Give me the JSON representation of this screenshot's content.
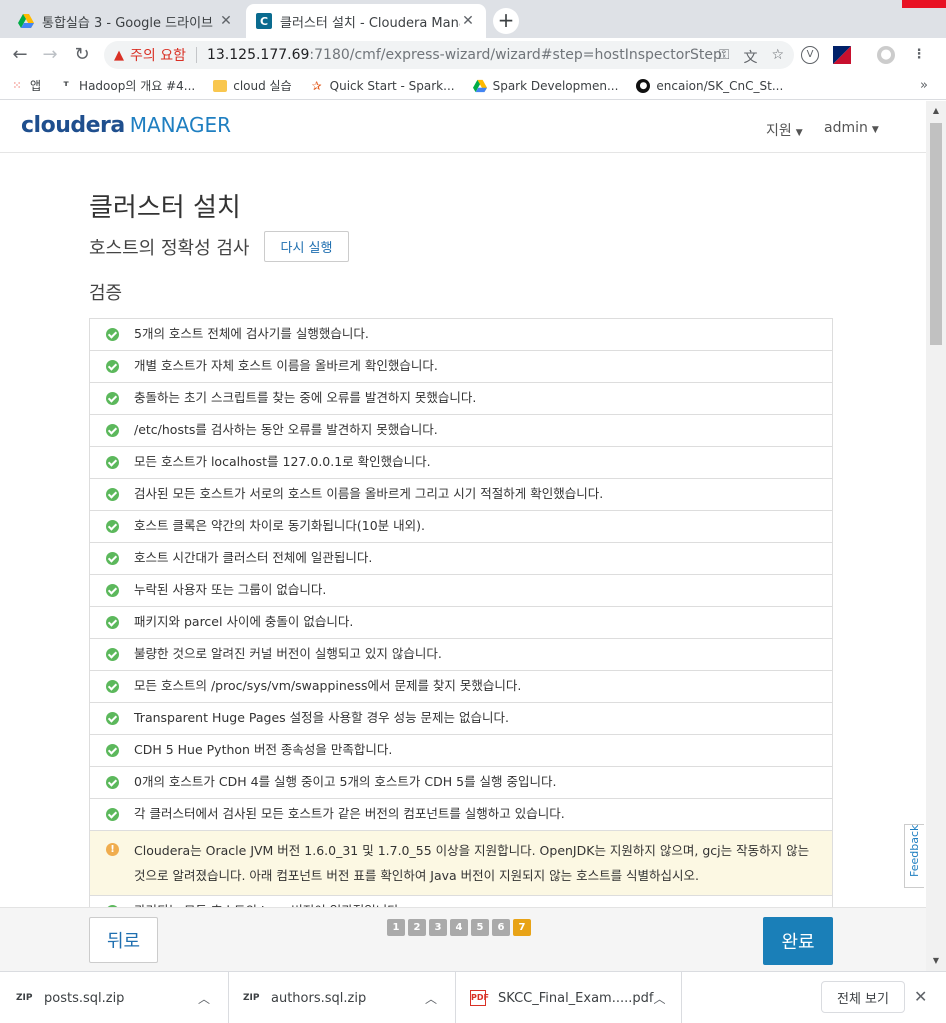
{
  "browser": {
    "tabs": [
      {
        "title": "통합실습 3 - Google 드라이브"
      },
      {
        "title": "클러스터 설치 - Cloudera Mana"
      }
    ],
    "address": {
      "warning": "주의 요함",
      "host": "13.125.177.69",
      "path": ":7180/cmf/express-wizard/wizard#step=hostInspectorStep"
    },
    "bookmarks": [
      {
        "label": "앱",
        "icon": "apps-grid-icon"
      },
      {
        "label": "Hadoop의 개요 #4...",
        "icon": "hadoop-icon"
      },
      {
        "label": "cloud 실습",
        "icon": "folder-icon"
      },
      {
        "label": "Quick Start - Spark...",
        "icon": "spark-star-icon"
      },
      {
        "label": "Spark Developmen...",
        "icon": "google-drive-icon"
      },
      {
        "label": "encaion/SK_CnC_St...",
        "icon": "github-icon"
      }
    ],
    "bookmarks_more": "»"
  },
  "header": {
    "logo_brand": "cloudera",
    "logo_product": "MANAGER",
    "support_menu": "지원",
    "user_menu": "admin"
  },
  "wizard": {
    "title": "클러스터 설치",
    "subtitle": "호스트의 정확성 검사",
    "rerun_label": "다시 실행",
    "section": "검증",
    "checks": [
      {
        "status": "ok",
        "text": "5개의 호스트 전체에 검사기를 실행했습니다."
      },
      {
        "status": "ok",
        "text": "개별 호스트가 자체 호스트 이름을 올바르게 확인했습니다."
      },
      {
        "status": "ok",
        "text": "충돌하는 초기 스크립트를 찾는 중에 오류를 발견하지 못했습니다."
      },
      {
        "status": "ok",
        "text": "/etc/hosts를 검사하는 동안 오류를 발견하지 못했습니다."
      },
      {
        "status": "ok",
        "text": "모든 호스트가 localhost를 127.0.0.1로 확인했습니다."
      },
      {
        "status": "ok",
        "text": "검사된 모든 호스트가 서로의 호스트 이름을 올바르게 그리고 시기 적절하게 확인했습니다."
      },
      {
        "status": "ok",
        "text": "호스트 클록은 약간의 차이로 동기화됩니다(10분 내외)."
      },
      {
        "status": "ok",
        "text": "호스트 시간대가 클러스터 전체에 일관됩니다."
      },
      {
        "status": "ok",
        "text": "누락된 사용자 또는 그룹이 없습니다."
      },
      {
        "status": "ok",
        "text": "패키지와 parcel 사이에 충돌이 없습니다."
      },
      {
        "status": "ok",
        "text": "불량한 것으로 알려진 커널 버전이 실행되고 있지 않습니다."
      },
      {
        "status": "ok",
        "text": "모든 호스트의 /proc/sys/vm/swappiness에서 문제를 찾지 못했습니다."
      },
      {
        "status": "ok",
        "text": "Transparent Huge Pages 설정을 사용할 경우 성능 문제는 없습니다."
      },
      {
        "status": "ok",
        "text": "CDH 5 Hue Python 버전 종속성을 만족합니다."
      },
      {
        "status": "ok",
        "text": "0개의 호스트가 CDH 4를 실행 중이고 5개의 호스트가 CDH 5를 실행 중입니다."
      },
      {
        "status": "ok",
        "text": "각 클러스터에서 검사된 모든 호스트가 같은 버전의 컴포넌트를 실행하고 있습니다."
      },
      {
        "status": "warn",
        "text": "Cloudera는 Oracle JVM 버전 1.6.0_31 및 1.7.0_55 이상을 지원합니다. OpenJDK는 지원하지 않으며, gcj는 작동하지 않는 것으로 알려졌습니다. 아래 컴포넌트 버전 표를 확인하여 Java 버전이 지원되지 않는 호스트를 식별하십시오."
      },
      {
        "status": "ok",
        "text": "관리되는 모든 호스트의 Java 버전이 일관적입니다."
      }
    ],
    "back_label": "뒤로",
    "done_label": "완료",
    "steps": [
      "1",
      "2",
      "3",
      "4",
      "5",
      "6",
      "7"
    ],
    "current_step": "7",
    "feedback_label": "Feedback"
  },
  "downloads": {
    "items": [
      {
        "name": "posts.sql.zip",
        "icon": "zip-file-icon"
      },
      {
        "name": "authors.sql.zip",
        "icon": "zip-file-icon"
      },
      {
        "name": "SKCC_Final_Exam.....pdf",
        "icon": "pdf-file-icon"
      }
    ],
    "show_all_label": "전체 보기"
  },
  "colors": {
    "cloudera_blue": "#1f4f8e",
    "primary_button": "#1a7fb8",
    "ok_green": "#5cb85c",
    "warn_bg": "#fcf8e3",
    "warn_icon": "#f0ad4e",
    "current_step": "#e8a317",
    "security_warning": "#d93025"
  }
}
